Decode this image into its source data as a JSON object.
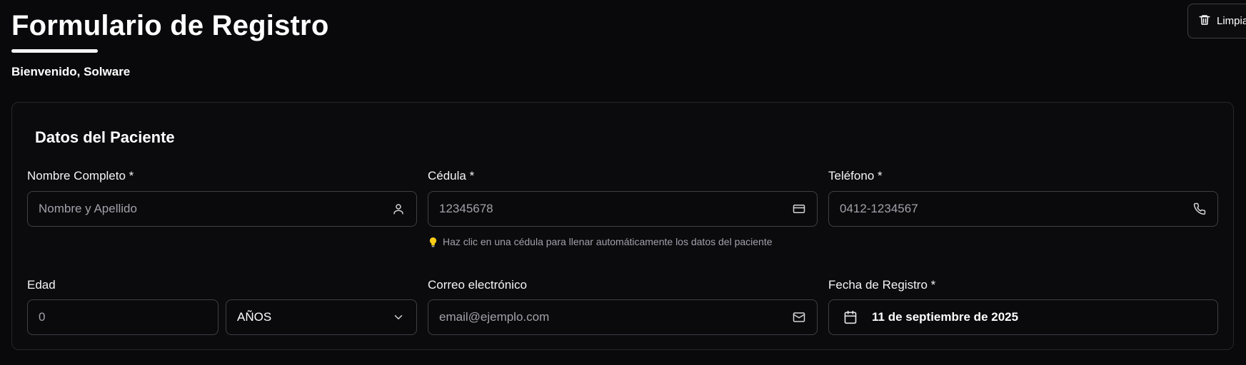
{
  "header": {
    "title": "Formulario de Registro",
    "welcome": "Bienvenido, Solware",
    "clear_button_label": "Limpia"
  },
  "section": {
    "title": "Datos del Paciente"
  },
  "fields": {
    "full_name": {
      "label": "Nombre Completo *",
      "placeholder": "Nombre y Apellido",
      "value": ""
    },
    "cedula": {
      "label": "Cédula *",
      "placeholder": "12345678",
      "value": ""
    },
    "phone": {
      "label": "Teléfono *",
      "placeholder": "0412-1234567",
      "value": ""
    },
    "age": {
      "label": "Edad",
      "placeholder": "0",
      "value": ""
    },
    "age_unit": {
      "selected": "AÑOS"
    },
    "email": {
      "label": "Correo electrónico",
      "placeholder": "email@ejemplo.com",
      "value": ""
    },
    "registration_date": {
      "label": "Fecha de Registro *",
      "value": "11 de septiembre de 2025"
    }
  },
  "hint": {
    "text": "Haz clic en una cédula para llenar automáticamente los datos del paciente",
    "icon": "lightbulb-icon"
  },
  "icons": {
    "clear": "trash-icon",
    "full_name": "user-icon",
    "cedula": "id-card-icon",
    "phone": "phone-icon",
    "age_unit": "chevron-down-icon",
    "email": "mail-icon",
    "registration_date": "calendar-icon"
  },
  "colors": {
    "background": "#09090b",
    "card_border": "#27272a",
    "input_border": "#3f3f46",
    "text": "#fafafa",
    "muted": "#a1a1aa",
    "hint_bulb": "#facc15"
  }
}
